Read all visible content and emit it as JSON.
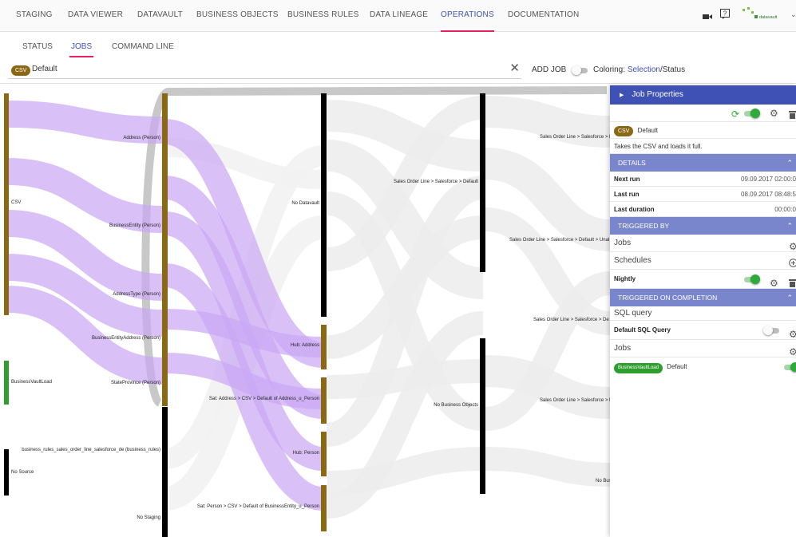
{
  "nav": {
    "tabs": [
      "STAGING",
      "DATA VIEWER",
      "DATAVAULT",
      "BUSINESS OBJECTS",
      "BUSINESS RULES",
      "DATA LINEAGE",
      "OPERATIONS",
      "DOCUMENTATION"
    ],
    "active_tab": "OPERATIONS",
    "logo_text": "datavault"
  },
  "subnav": {
    "tabs": [
      "STATUS",
      "JOBS",
      "COMMAND LINE"
    ],
    "active_tab": "JOBS"
  },
  "filter": {
    "chip": "CSV",
    "value": "Default"
  },
  "toolbar": {
    "add_job": "ADD JOB",
    "coloring_prefix": "Coloring: ",
    "coloring_selection": "Selection",
    "coloring_sep": "/",
    "coloring_status": "Status"
  },
  "colors": {
    "accent": "#3f51b5",
    "active_underline": "#e91e63",
    "olive_node": "#8b6914",
    "green_node": "#2e9e2e",
    "flow_highlight": "#c9a7f5",
    "flow_default": "#ececec",
    "panel_header": "#3f51b5",
    "section_header": "#7986cb",
    "toggle_on": "#2eaa3a"
  },
  "sankey": {
    "labels": {
      "csv": "CSV",
      "business_vault_load": "BusinessVaultLoad",
      "no_source": "No Source",
      "address_person": "Address (Person)",
      "business_entity_person": "BusinessEntity (Person)",
      "address_type_person": "AddressType (Person)",
      "business_entity_address_person": "BusinessEntityAddress (Person)",
      "state_province_person": "StateProvince (Person)",
      "business_rules_node": "business_rules_sales_order_line_salesforce_de (business_rules)",
      "no_staging": "No Staging",
      "no_datavault": "No Datavault",
      "hub_address": "Hub: Address",
      "sat_address": "Sat: Address > CSV > Default of Address_u_Person",
      "hub_person": "Hub: Person",
      "sat_person": "Sat: Person > CSV > Default of BusinessEntity_u_Person",
      "sales_order_line_default": "Sales Order Line > Salesforce > Default",
      "no_business_objects": "No Business Objects",
      "sol_c1": "Sales Order Line > Salesforce > D",
      "sol_c2": "Sales Order Line > Salesforce > Default > Unal",
      "sol_c3": "Sales Order Line > Salesforce > De",
      "sol_c4": "Sales Order Line > Salesforce > D",
      "no_bus": "No Bus"
    }
  },
  "panel": {
    "title": "Job Properties",
    "job_chip": "CSV",
    "job_name": "Default",
    "description": "Takes the CSV and loads it full.",
    "details_header": "DETAILS",
    "details": [
      {
        "label": "Next run",
        "value": "09.09.2017 02:00:0"
      },
      {
        "label": "Last run",
        "value": "08.09.2017 08:48:5"
      },
      {
        "label": "Last duration",
        "value": "00:00:0"
      }
    ],
    "triggered_by_header": "TRIGGERED BY",
    "jobs_label": "Jobs",
    "schedules_label": "Schedules",
    "schedule_name": "Nightly",
    "triggered_on_completion_header": "TRIGGERED ON COMPLETION",
    "sql_query_label": "SQL query",
    "default_sql_query": "Default SQL Query",
    "completion_jobs_label": "Jobs",
    "completion_job_chip": "BusinessVaultLoad",
    "completion_job_name": "Default"
  }
}
